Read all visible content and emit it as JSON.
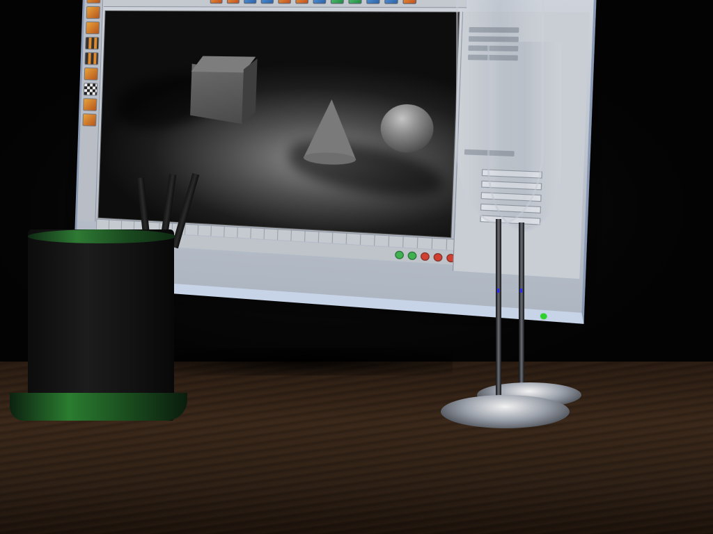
{
  "scene": {
    "subject": "3d-render",
    "colors": {
      "monitor_frame": "#c7d3e6",
      "ui_panel": "#c4c9d0",
      "viewport_background": "#4e4e4e",
      "desk_wood": "#3a281a",
      "cup_trim": "#2e7a34",
      "status_led": "#2fd12f",
      "stem_light": "#2828ff"
    },
    "monitor": {
      "left_toolbar_icons": [
        "move-icon",
        "scale-icon",
        "rotate-icon",
        "grid-icon",
        "grid-icon",
        "cube-icon",
        "checker-icon",
        "edit-icon",
        "paint-icon"
      ],
      "top_toolbar_icons": [
        "undo-icon",
        "redo-icon",
        "select-icon",
        "move-icon",
        "render-icon",
        "render-settings-icon",
        "cube-icon",
        "sphere-icon",
        "light-icon",
        "camera-icon",
        "deformer-icon",
        "material-icon"
      ],
      "viewport_objects": [
        "cube",
        "cone",
        "sphere"
      ]
    },
    "desk_objects": [
      "pencil-cup",
      "wine-glass",
      "wine-glass"
    ]
  }
}
